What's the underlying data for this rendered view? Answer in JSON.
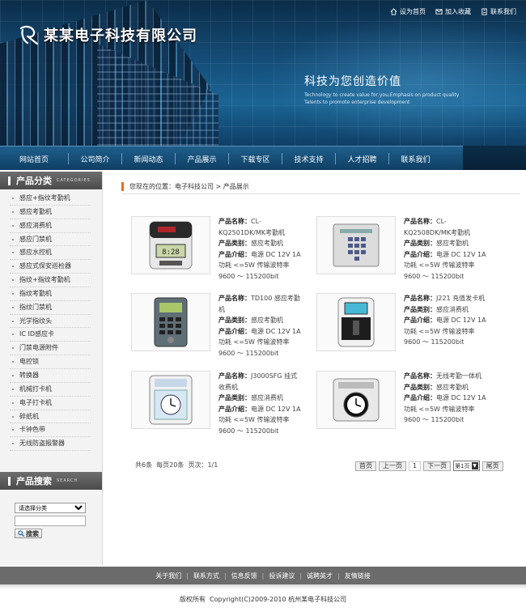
{
  "header": {
    "company_name": "某某电子科技有限公司",
    "top_links": [
      {
        "label": "设为首页",
        "icon": "home-icon"
      },
      {
        "label": "加入收藏",
        "icon": "bookmark-icon"
      },
      {
        "label": "联系我们",
        "icon": "contact-icon"
      }
    ],
    "slogan": "科技为您创造价值",
    "slogan_en_line1": "Technology to create value for you,Emphasis on product quality",
    "slogan_en_line2": "Talents to promote enterprise development"
  },
  "nav": [
    "网站首页",
    "公司简介",
    "新闻动态",
    "产品展示",
    "下载专区",
    "技术支持",
    "人才招聘",
    "联系我们"
  ],
  "sidebar": {
    "category_title": "产品分类",
    "category_title_en": "CATEGORIES",
    "categories": [
      "感应+指纹考勤机",
      "感应考勤机",
      "感应消费机",
      "感应门禁机",
      "感应水控机",
      "感应式保安巡检器",
      "指纹+指纹考勤机",
      "指纹考勤机",
      "指纹门禁机",
      "光学指纹头",
      "IC ID感应卡",
      "门禁电源附件",
      "电控锁",
      "转换器",
      "机械打卡机",
      "电子打卡机",
      "碎纸机",
      "卡钟色带",
      "无线防盗报警器"
    ],
    "search_title": "产品搜索",
    "search_title_en": "SEARCH",
    "search_select": "请选择分类",
    "search_input": "",
    "search_button": "搜索"
  },
  "breadcrumb": {
    "prefix": "您现在的位置：",
    "home": "电子科技公司",
    "sep": " > ",
    "current": "产品展示"
  },
  "labels": {
    "name": "产品名称：",
    "type": "产品类别：",
    "intro": "产品介绍："
  },
  "products": [
    {
      "name": "CL-KQ2501DK/MK考勤机",
      "type": "感应考勤机",
      "intro": "电源 DC 12V 1A 功耗 <=5W 传输波特率 9600 ～ 115200bit"
    },
    {
      "name": "CL-KQ2508DK/MK考勤机",
      "type": "感应考勤机",
      "intro": "电源 DC 12V 1A 功耗 <=5W 传输波特率 9600 ～ 115200bit"
    },
    {
      "name": "TD100 感应考勤机",
      "type": "感应考勤机",
      "intro": "电源 DC 12V 1A 功耗 <=5W 传输波特率 9600 ～ 115200bit"
    },
    {
      "name": "J221 充值发卡机",
      "type": "感应消费机",
      "intro": "电源 DC 12V 1A 功耗 <=5W 传输波特率 9600 ～ 115200bit"
    },
    {
      "name": "J3000SFG 挂式收费机",
      "type": "感应消费机",
      "intro": "电源 DC 12V 1A 功耗 <=5W 传输波特率 9600 ～ 115200bit"
    },
    {
      "name": "无线考勤一体机",
      "type": "感应考勤机",
      "intro": "电源 DC 12V 1A 功耗 <=5W 传输波特率 9600 ～ 115200bit"
    }
  ],
  "pager": {
    "summary": "共6条  每页20条  页次：1/1",
    "first": "首页",
    "prev": "上一页",
    "current": "1",
    "next": "下一页",
    "select": "第1页",
    "last": "尾页"
  },
  "footer": {
    "links": [
      "关于我们",
      "联系方式",
      "信息反馈",
      "投诉建议",
      "诚聘英才",
      "友情链接"
    ],
    "copyright": "版权所有  Copyright(C)2009-2010 杭州某电子科技公司"
  }
}
